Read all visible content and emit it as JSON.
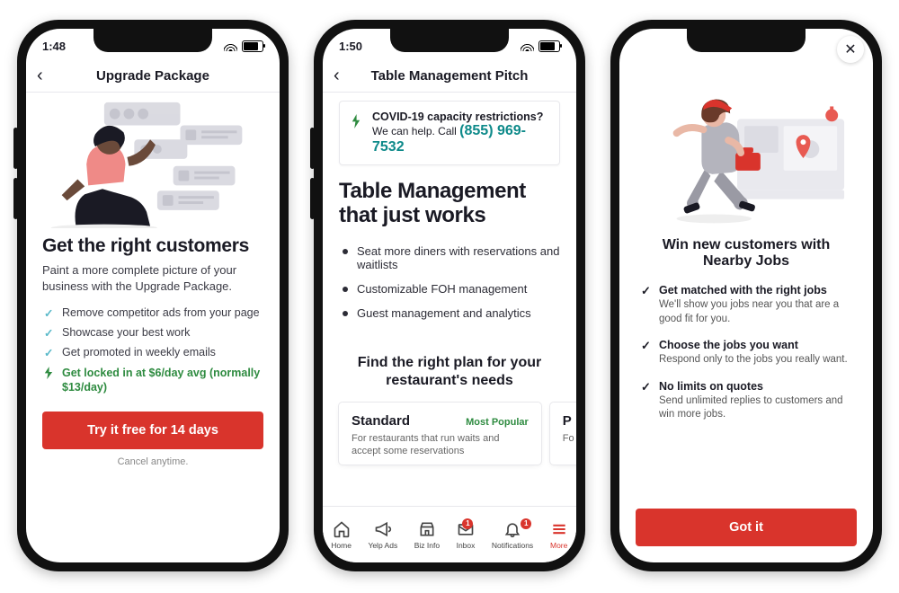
{
  "phone1": {
    "time": "1:48",
    "title": "Upgrade Package",
    "headline": "Get the right customers",
    "sub": "Paint a more complete picture of your business with the Upgrade Package.",
    "checks": [
      "Remove competitor ads from your page",
      "Showcase your best work",
      "Get promoted in weekly emails"
    ],
    "promo": "Get locked in at $6/day avg (normally $13/day)",
    "cta": "Try it free for 14 days",
    "fine": "Cancel anytime."
  },
  "phone2": {
    "time": "1:50",
    "title": "Table Management Pitch",
    "covid_bold": "COVID-19 capacity restrictions?",
    "covid_text": "We can help. Call ",
    "covid_phone": "(855) 969-7532",
    "headline": "Table Management that just works",
    "bullets": [
      "Seat more diners with reservations and waitlists",
      "Customizable FOH management",
      "Guest management and analytics"
    ],
    "plan_headline": "Find the right plan for your restaurant's needs",
    "card1_name": "Standard",
    "card1_tag": "Most Popular",
    "card1_desc": "For restaurants that run waits and accept some reservations",
    "card2_name": "P",
    "card2_desc": "Fo a",
    "tabs": [
      {
        "label": "Home"
      },
      {
        "label": "Yelp Ads"
      },
      {
        "label": "Biz Info"
      },
      {
        "label": "Inbox",
        "badge": "1"
      },
      {
        "label": "Notifications",
        "badge": "1"
      },
      {
        "label": "More"
      }
    ]
  },
  "phone3": {
    "headline": "Win new customers with Nearby Jobs",
    "features": [
      {
        "t": "Get matched with the right jobs",
        "d": "We'll show you jobs near you that are a good fit for you."
      },
      {
        "t": "Choose the jobs you want",
        "d": "Respond only to the jobs you really want."
      },
      {
        "t": "No limits on quotes",
        "d": "Send unlimited replies to customers and win more jobs."
      }
    ],
    "cta": "Got it"
  }
}
